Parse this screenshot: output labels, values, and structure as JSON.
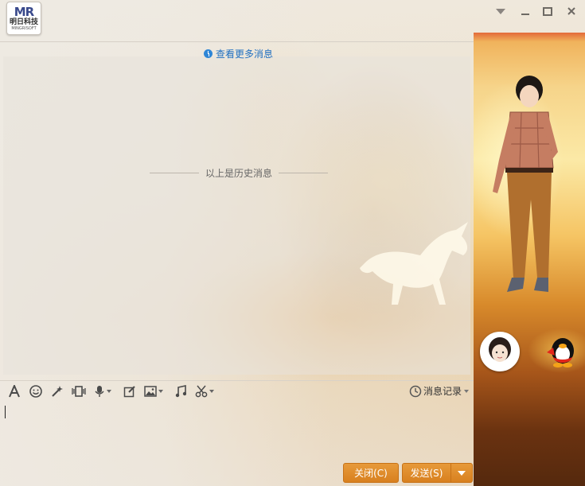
{
  "window": {
    "logo": {
      "mark": "MR",
      "name_cn": "明日科技",
      "name_en": "MINGRISOFT"
    }
  },
  "history": {
    "more_messages": "查看更多消息",
    "divider_text": "以上是历史消息"
  },
  "toolbar": {
    "tools": [
      "font-icon",
      "emoji-icon",
      "magic-icon",
      "screen-shake-icon",
      "voice-icon",
      "edit-icon",
      "image-icon",
      "music-icon",
      "scissors-icon"
    ],
    "history_label": "消息记录"
  },
  "input": {
    "value": ""
  },
  "actions": {
    "close_label": "关闭(C)",
    "send_label": "发送(S)"
  },
  "colors": {
    "accent_link": "#1f6fc1",
    "button_orange": "#e08a2b"
  }
}
